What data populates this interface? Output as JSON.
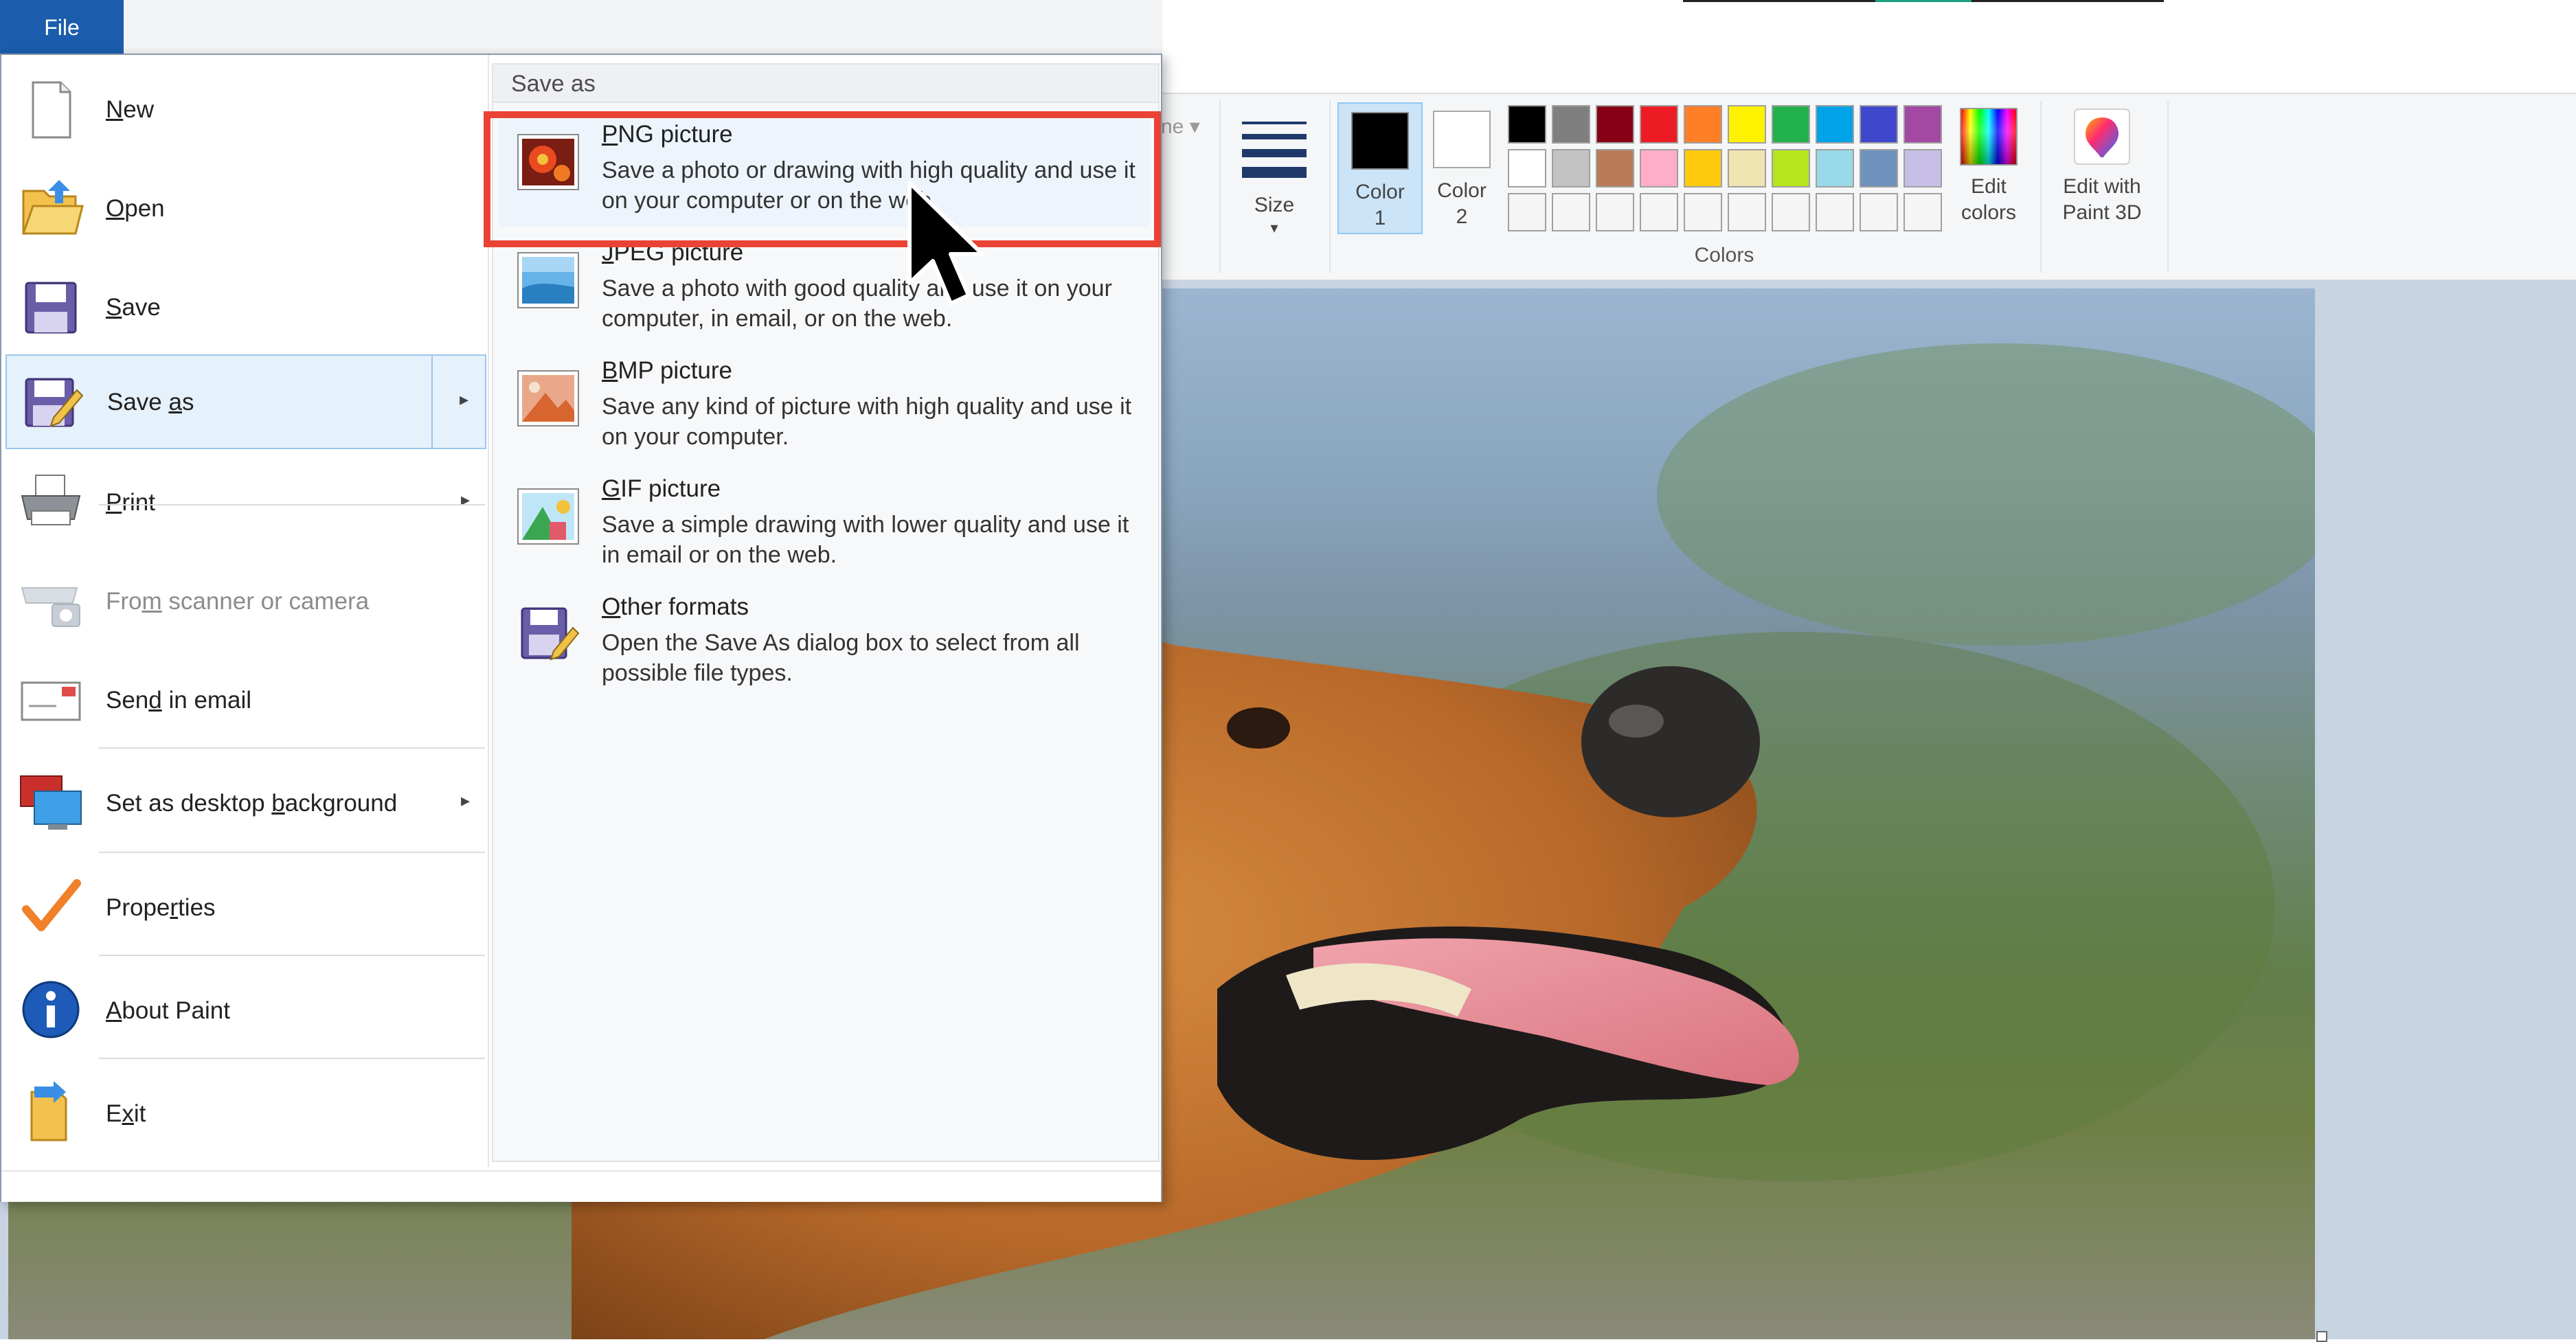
{
  "file_tab": {
    "label": "File"
  },
  "ribbon": {
    "ghost_text": "ne ▾",
    "size": {
      "label": "Size",
      "arrow": "▾"
    },
    "color1": {
      "label_top": "Color",
      "label_bottom": "1",
      "color": "#000000"
    },
    "color2": {
      "label_top": "Color",
      "label_bottom": "2",
      "color": "#ffffff"
    },
    "palette": [
      [
        "#000000",
        "#7f7f7f",
        "#880015",
        "#ed1c24",
        "#ff7f27",
        "#fff200",
        "#22b14c",
        "#00a2e8",
        "#3f48cc",
        "#a349a4"
      ],
      [
        "#ffffff",
        "#c3c3c3",
        "#b97a57",
        "#ffaec9",
        "#ffc90e",
        "#efe4b0",
        "#b5e61d",
        "#99d9ea",
        "#7092be",
        "#c8bfe7"
      ],
      [
        "#f5f5f5",
        "#f5f5f5",
        "#f5f5f5",
        "#f5f5f5",
        "#f5f5f5",
        "#f5f5f5",
        "#f5f5f5",
        "#f5f5f5",
        "#f5f5f5",
        "#f5f5f5"
      ]
    ],
    "colors_group_label": "Colors",
    "edit_colors": {
      "label_top": "Edit",
      "label_bottom": "colors"
    },
    "edit_paint3d": {
      "label_top": "Edit with",
      "label_bottom": "Paint 3D"
    }
  },
  "left_menu": {
    "new": {
      "pre": "",
      "key": "N",
      "post": "ew"
    },
    "open": {
      "pre": "",
      "key": "O",
      "post": "pen"
    },
    "save": {
      "pre": "",
      "key": "S",
      "post": "ave"
    },
    "save_as": {
      "pre": "Save ",
      "key": "a",
      "post": "s"
    },
    "print": {
      "pre": "",
      "key": "P",
      "post": "rint"
    },
    "scanner": {
      "pre": "Fro",
      "key": "m",
      "post": " scanner or camera"
    },
    "email": {
      "pre": "Sen",
      "key": "d",
      "post": " in email"
    },
    "desktop_bg": {
      "pre": "Set as desktop ",
      "key": "b",
      "post": "ackground"
    },
    "properties": {
      "pre": "Prope",
      "key": "r",
      "post": "ties"
    },
    "about": {
      "pre": "",
      "key": "A",
      "post": "bout Paint"
    },
    "exit": {
      "pre": "E",
      "key": "x",
      "post": "it"
    },
    "submenu_arrow": "▸"
  },
  "save_as_panel": {
    "header": "Save as",
    "items": [
      {
        "key": "P",
        "rest": "NG picture",
        "desc": "Save a photo or drawing with high quality and use it on your computer or on the web."
      },
      {
        "key": "J",
        "rest": "PEG picture",
        "desc": "Save a photo with good quality and use it on your computer, in email, or on the web."
      },
      {
        "key": "B",
        "rest": "MP picture",
        "desc": "Save any kind of picture with high quality and use it on your computer."
      },
      {
        "key": "G",
        "rest": "IF picture",
        "desc": "Save a simple drawing with lower quality and use it in email or on the web."
      },
      {
        "key": "O",
        "rest": "ther formats",
        "desc": "Open the Save As dialog box to select from all possible file types."
      }
    ]
  }
}
